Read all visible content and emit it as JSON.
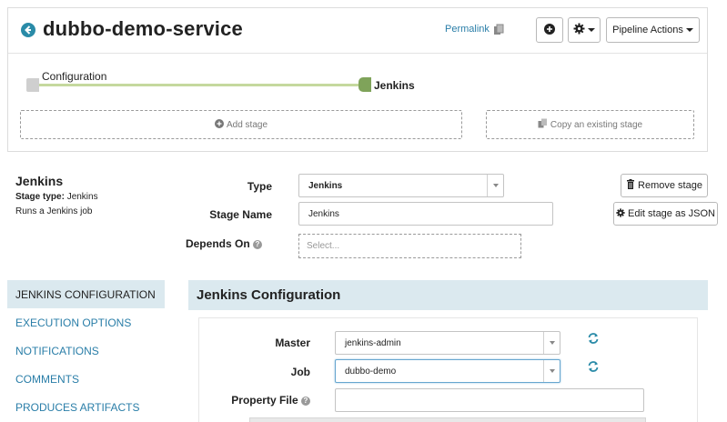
{
  "header": {
    "title": "dubbo-demo-service",
    "permalink": "Permalink",
    "pipeline_actions": "Pipeline Actions"
  },
  "graph": {
    "stages": [
      "Configuration",
      "Jenkins"
    ],
    "add_stage": "Add stage",
    "copy_stage": "Copy an existing stage"
  },
  "stage": {
    "name": "Jenkins",
    "type_label": "Stage type:",
    "type_value": "Jenkins",
    "description": "Runs a Jenkins job"
  },
  "form": {
    "type_label": "Type",
    "type_value": "Jenkins",
    "stage_name_label": "Stage Name",
    "stage_name_value": "Jenkins",
    "depends_on_label": "Depends On",
    "depends_on_placeholder": "Select...",
    "remove_stage": "Remove stage",
    "edit_json": "Edit stage as JSON"
  },
  "nav": {
    "items": [
      {
        "label": "JENKINS CONFIGURATION",
        "active": true
      },
      {
        "label": "EXECUTION OPTIONS",
        "active": false
      },
      {
        "label": "NOTIFICATIONS",
        "active": false
      },
      {
        "label": "COMMENTS",
        "active": false
      },
      {
        "label": "PRODUCES ARTIFACTS",
        "active": false
      }
    ]
  },
  "config": {
    "heading": "Jenkins Configuration",
    "master_label": "Master",
    "master_value": "jenkins-admin",
    "job_label": "Job",
    "job_value": "dubbo-demo",
    "property_file_label": "Property File",
    "property_file_value": ""
  },
  "colors": {
    "accent": "#2a7ea8",
    "active_nav_bg": "#dbe9ef",
    "stage_done": "#7fa35a",
    "graph_line": "#c5d99e"
  },
  "icons": [
    "back-arrow-icon",
    "copy-link-icon",
    "plus-circle-icon",
    "gear-icon",
    "trash-icon",
    "cog-icon",
    "copy-icon",
    "question-icon",
    "refresh-icon"
  ]
}
